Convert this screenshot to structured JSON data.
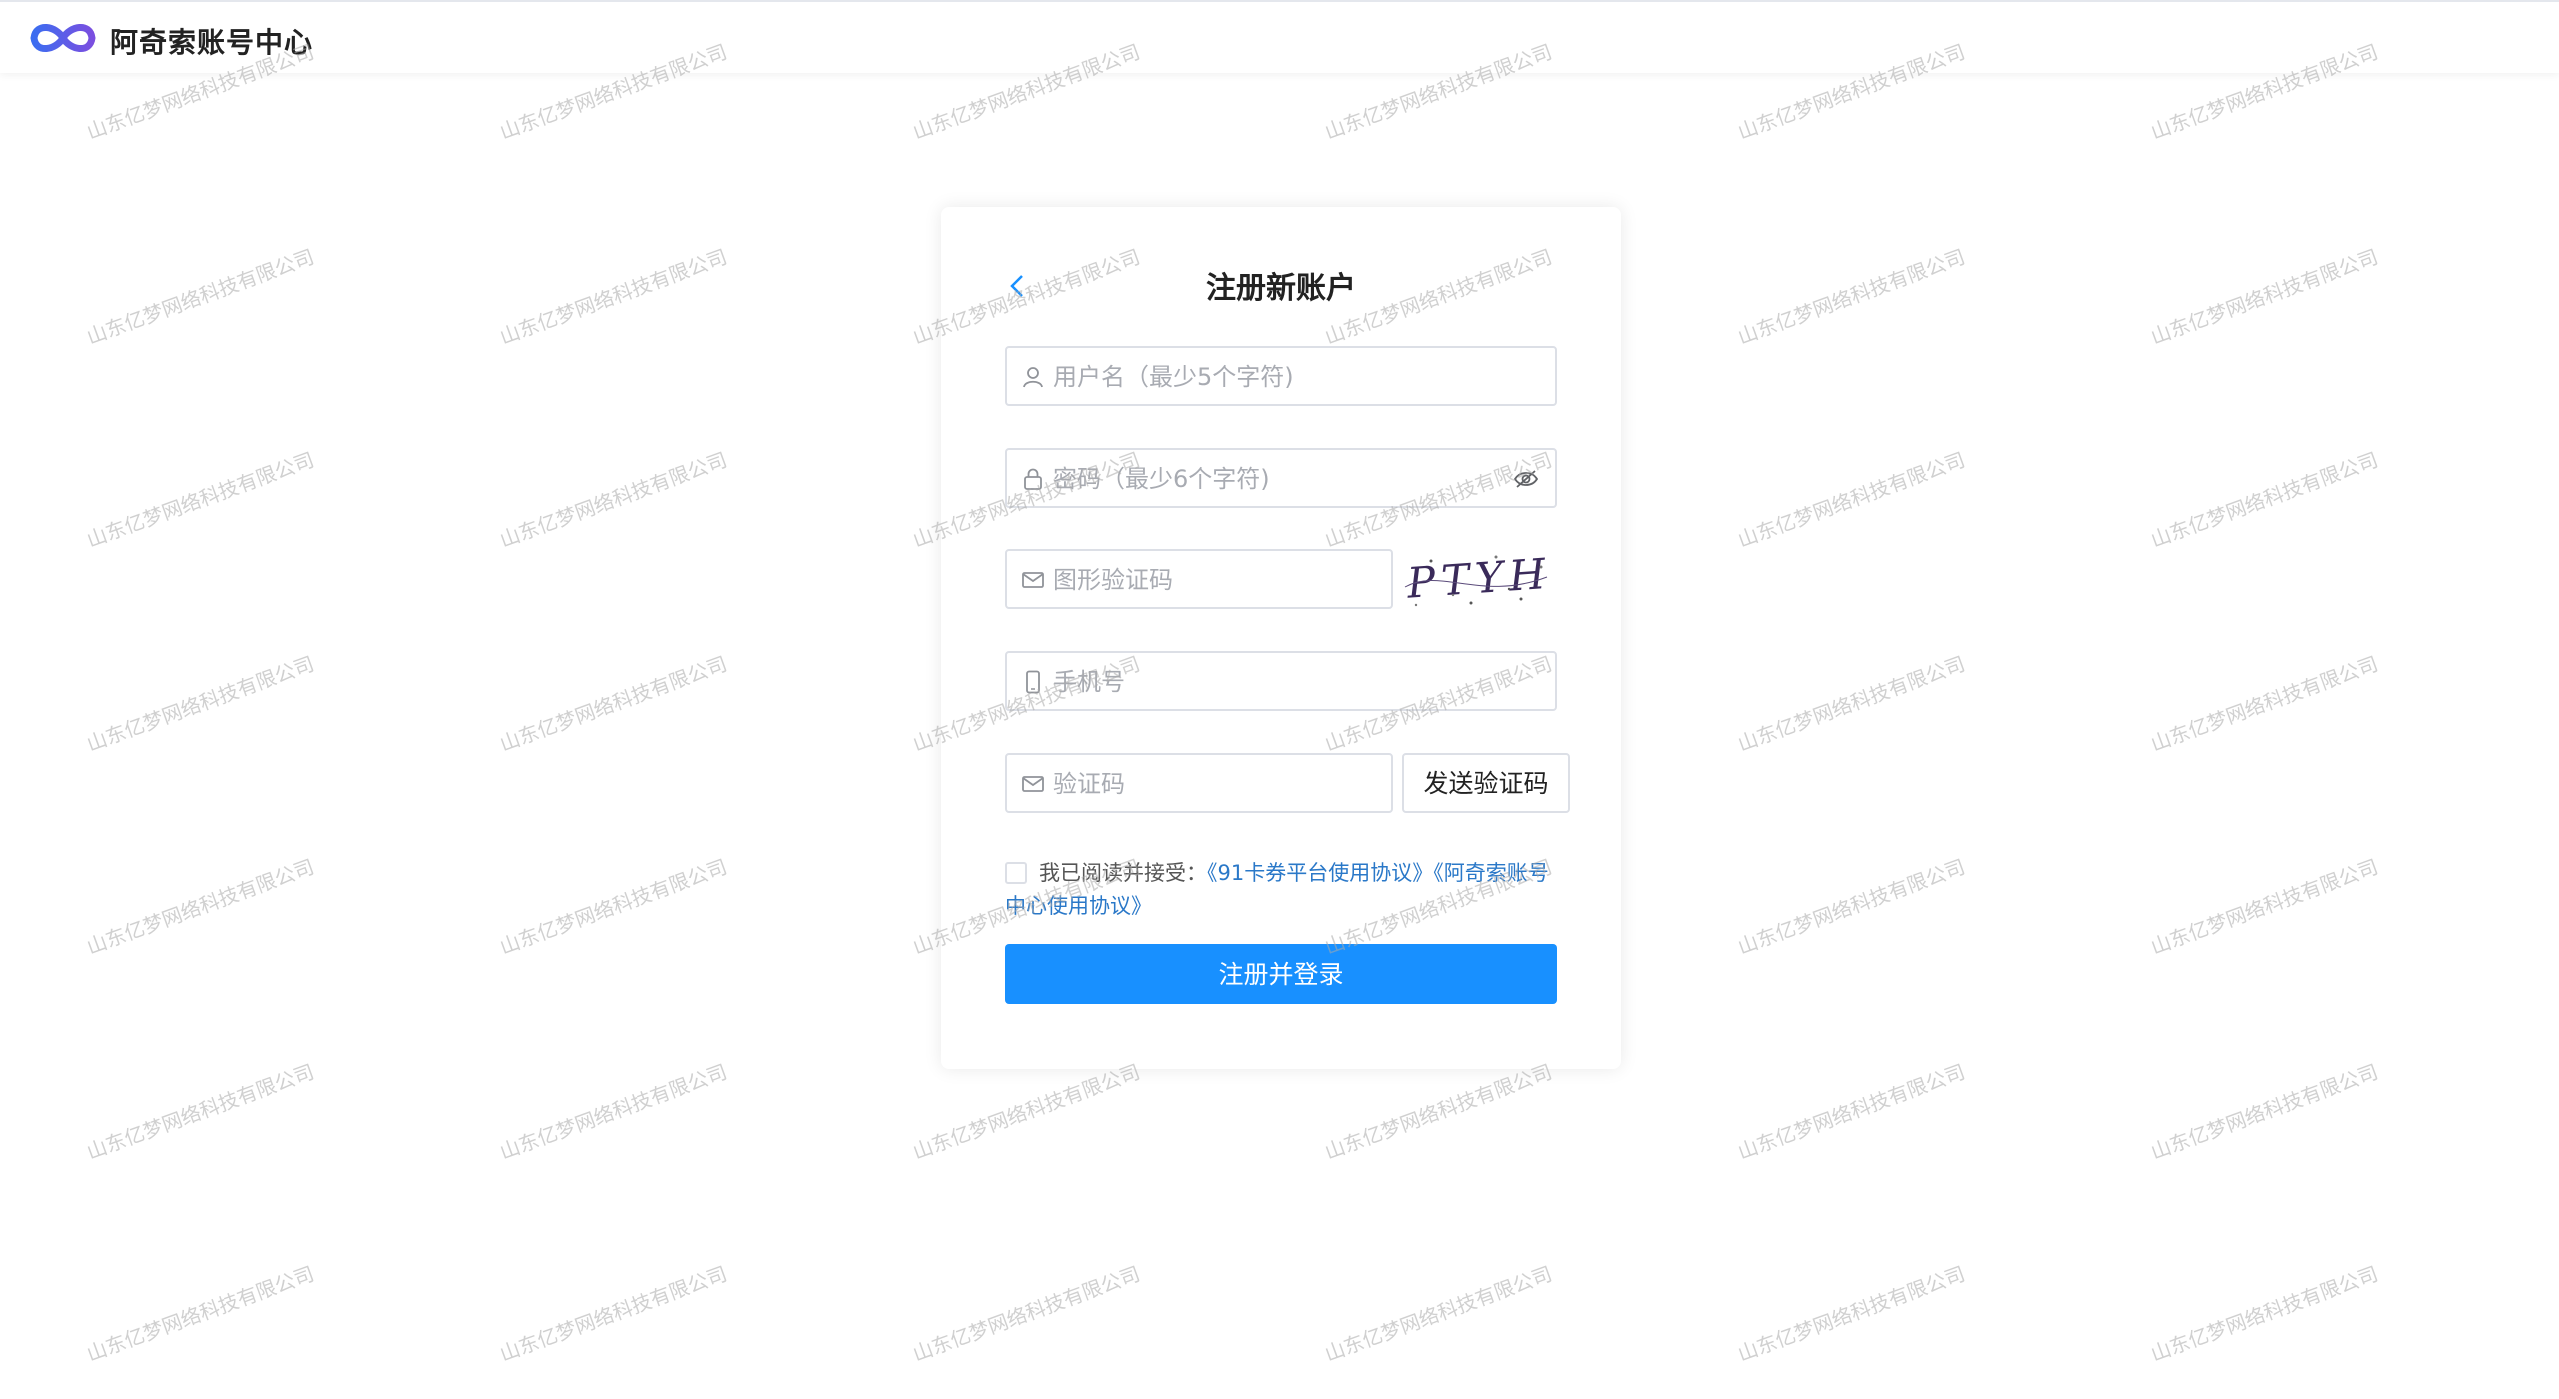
{
  "header": {
    "title": "阿奇索账号中心",
    "logo_icon": "infinity-logo-icon"
  },
  "register": {
    "title": "注册新账户",
    "back_icon": "chevron-left-icon",
    "username": {
      "placeholder": "用户名（最少5个字符)",
      "value": "",
      "icon": "user-icon"
    },
    "password": {
      "placeholder": "密码（最少6个字符)",
      "value": "",
      "icon": "lock-icon",
      "toggle_icon": "eye-hidden-icon"
    },
    "captcha": {
      "placeholder": "图形验证码",
      "value": "",
      "icon": "mail-icon",
      "image_text": "PTYH"
    },
    "phone": {
      "placeholder": "手机号",
      "value": "",
      "icon": "mobile-phone-icon"
    },
    "sms_code": {
      "placeholder": "验证码",
      "value": "",
      "icon": "mail-icon"
    },
    "send_code_label": "发送验证码",
    "agreement": {
      "prefix": "我已阅读并接受：",
      "link1": "《91卡券平台使用协议》",
      "link2": "《阿奇索账号中心使用协议》"
    },
    "submit_label": "注册并登录"
  },
  "watermark": {
    "text": "山东亿梦网络科技有限公司"
  },
  "colors": {
    "primary": "#1890ff",
    "link": "#2a78c8",
    "logo_blue": "#3c6df0",
    "logo_purple": "#7a4fe0"
  }
}
